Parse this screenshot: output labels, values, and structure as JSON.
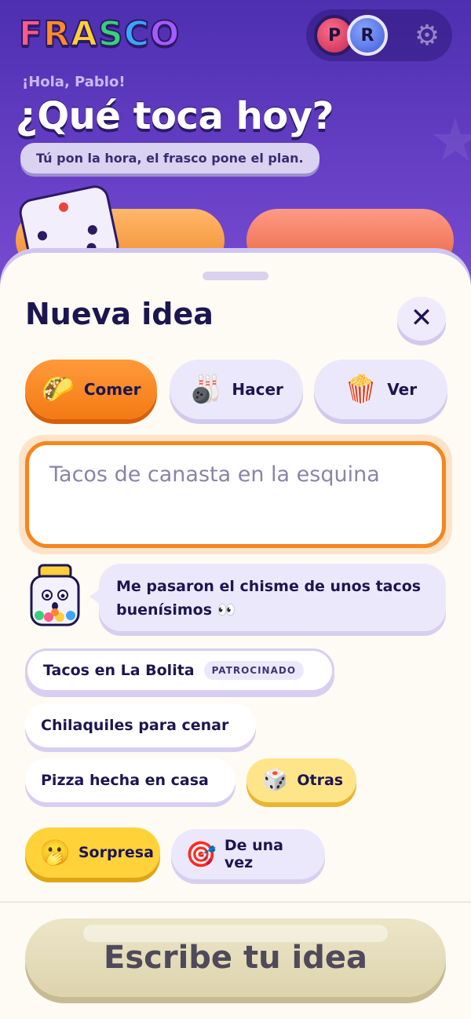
{
  "app": {
    "logo_letters": [
      "F",
      "R",
      "A",
      "S",
      "C",
      "O"
    ],
    "logo_colors": [
      "#ff5a8a",
      "#ff8a2a",
      "#ffcf3a",
      "#38d07a",
      "#3aa6ff",
      "#a65aff"
    ],
    "avatars": [
      "P",
      "R"
    ],
    "greeting": "¡Hola, Pablo!",
    "headline": "¿Qué toca hoy?",
    "subline": "Tú pon la hora, el frasco pone el plan."
  },
  "sheet": {
    "title": "Nueva idea",
    "close_symbol": "✕",
    "categories": [
      {
        "label": "Comer",
        "icon": "🌮",
        "active": true
      },
      {
        "label": "Hacer",
        "icon": "🎳",
        "active": false
      },
      {
        "label": "Ver",
        "icon": "🍿",
        "active": false
      }
    ],
    "input": {
      "placeholder": "Tacos de canasta en la esquina",
      "value": ""
    },
    "mascot_message": "Me pasaron el chisme de unos tacos buenísimos 👀",
    "suggestions": [
      {
        "label": "Tacos en La Bolita",
        "badge": "PATROCINADO"
      },
      {
        "label": "Chilaquiles para cenar"
      },
      {
        "label": "Pizza hecha en casa"
      }
    ],
    "more_button": {
      "label": "Otras",
      "icon": "🎲"
    },
    "actions": [
      {
        "label": "Sorpresa",
        "icon": "🫢"
      },
      {
        "label": "De una vez",
        "icon": "🎯"
      }
    ],
    "cta_label": "Escribe tu idea"
  },
  "colors": {
    "accent_orange": "#f47a14",
    "lavender": "#ece8fb",
    "navy_text": "#1c1650",
    "yellow": "#ffd23a"
  }
}
